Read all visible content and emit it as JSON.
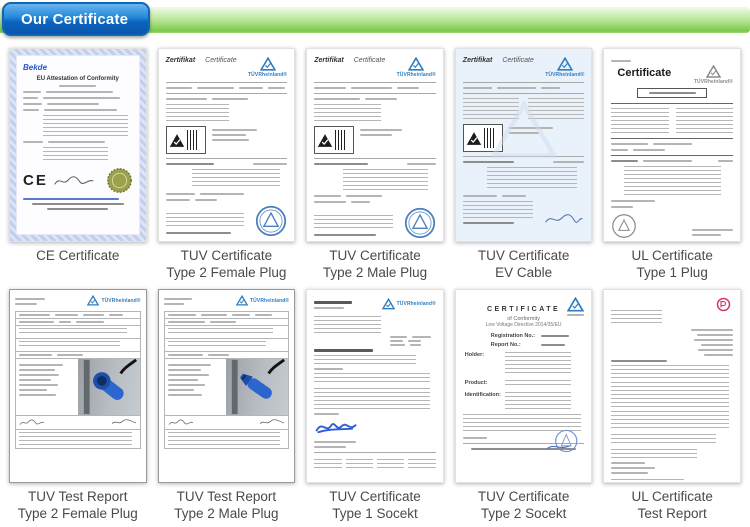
{
  "header": {
    "title": "Our Certificate"
  },
  "colors": {
    "header_green": "#7cc94e",
    "header_blue": "#0b62be",
    "tuv_blue": "#2f7dc2",
    "seal_olive": "#9aa04c",
    "stamp_blue": "#4a7fc1",
    "red_mark": "#d6356f",
    "plug_blue": "#2b66cf"
  },
  "certificates": [
    {
      "caption1": "CE Certificate",
      "caption2": "",
      "doc": {
        "brand": "Bekde",
        "title": "EU Attestation of Conformity",
        "ce_mark": "CE"
      }
    },
    {
      "caption1": "TUV Certificate",
      "caption2": "Type 2 Female Plug",
      "doc": {
        "title_de": "Zertifikat",
        "title_en": "Certificate",
        "logo": "TÜVRheinland®"
      }
    },
    {
      "caption1": "TUV Certificate",
      "caption2": "Type 2 Male Plug",
      "doc": {
        "title_de": "Zertifikat",
        "title_en": "Certificate",
        "logo": "TÜVRheinland®"
      }
    },
    {
      "caption1": "TUV Certificate",
      "caption2": "EV Cable",
      "doc": {
        "title_de": "Zertifikat",
        "title_en": "Certificate",
        "logo": "TÜVRheinland®"
      }
    },
    {
      "caption1": "UL Certificate",
      "caption2": "Type 1 Plug",
      "doc": {
        "title": "Certificate",
        "logo": "TÜVRheinland®"
      }
    },
    {
      "caption1": "TUV Test Report",
      "caption2": "Type 2 Female Plug",
      "doc": {
        "logo": "TÜVRheinland®"
      }
    },
    {
      "caption1": "TUV Test Report",
      "caption2": "Type 2 Male Plug",
      "doc": {
        "logo": "TÜVRheinland®"
      }
    },
    {
      "caption1": "TUV Certificate",
      "caption2": "Type 1 Socekt",
      "doc": {
        "logo": "TÜVRheinland®"
      }
    },
    {
      "caption1": "TUV Certificate",
      "caption2": "Type 2 Socekt",
      "doc": {
        "title": "CERTIFICATE",
        "subtitle": "of Conformity",
        "directive": "Low Voltage Directive 2014/35/EU",
        "registration_label": "Registration No.:",
        "report_label": "Report No.:",
        "holder_label": "Holder:",
        "product_label": "Product:",
        "identification_label": "Identification:"
      }
    },
    {
      "caption1": "UL Certificate",
      "caption2": "Test Report",
      "doc": {}
    }
  ]
}
